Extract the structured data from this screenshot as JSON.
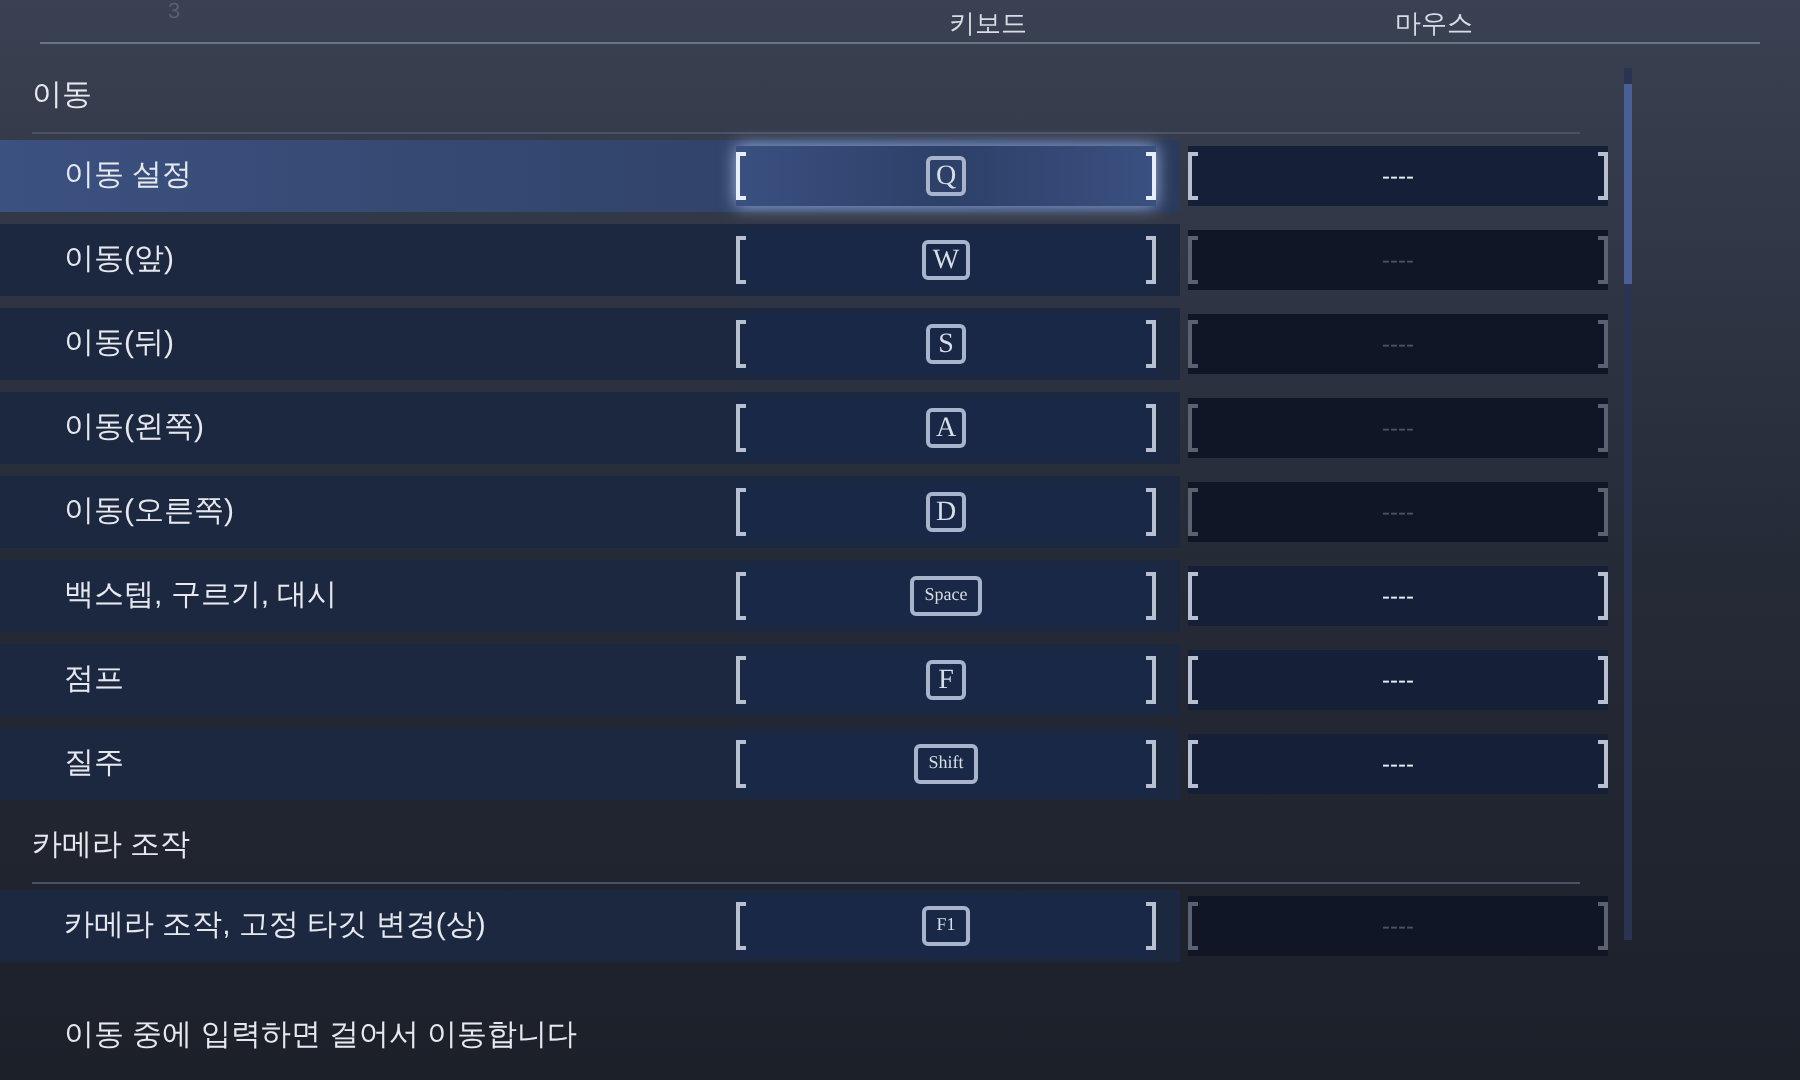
{
  "corner_label": "3",
  "columns": [
    "키보드",
    "마우스"
  ],
  "sections": [
    {
      "title": "이동",
      "items": [
        {
          "label": "이동 설정",
          "key": "Q",
          "selected": true,
          "mouse": "----",
          "mouse_disabled": false
        },
        {
          "label": "이동(앞)",
          "key": "W",
          "selected": false,
          "mouse": "----",
          "mouse_disabled": true
        },
        {
          "label": "이동(뒤)",
          "key": "S",
          "selected": false,
          "mouse": "----",
          "mouse_disabled": true
        },
        {
          "label": "이동(왼쪽)",
          "key": "A",
          "selected": false,
          "mouse": "----",
          "mouse_disabled": true
        },
        {
          "label": "이동(오른쪽)",
          "key": "D",
          "selected": false,
          "mouse": "----",
          "mouse_disabled": true
        },
        {
          "label": "백스텝, 구르기, 대시",
          "key": "Space",
          "selected": false,
          "mouse": "----",
          "mouse_disabled": false
        },
        {
          "label": "점프",
          "key": "F",
          "selected": false,
          "mouse": "----",
          "mouse_disabled": false
        },
        {
          "label": "질주",
          "key": "Shift",
          "selected": false,
          "mouse": "----",
          "mouse_disabled": false
        }
      ]
    },
    {
      "title": "카메라 조작",
      "items": [
        {
          "label": "카메라 조작, 고정 타깃 변경(상)",
          "key": "F1",
          "selected": false,
          "mouse": "----",
          "mouse_disabled": true
        }
      ]
    }
  ],
  "description": "이동 중에 입력하면 걸어서 이동합니다"
}
